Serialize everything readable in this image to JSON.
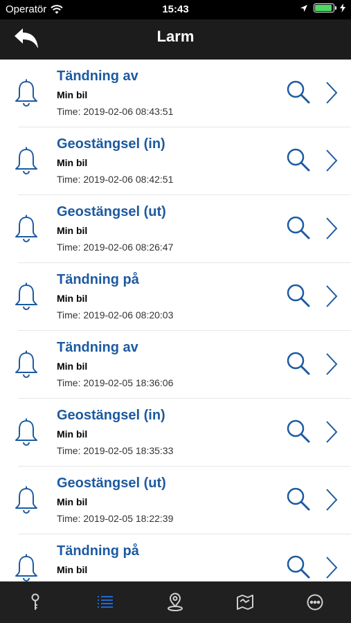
{
  "status_bar": {
    "carrier": "Operatör",
    "time": "15:43",
    "battery_color": "#4cd964"
  },
  "nav": {
    "title": "Larm",
    "back_icon": "back-arrow-icon"
  },
  "colors": {
    "accent": "#1c5aa0",
    "tab_active": "#1f6ad6",
    "tab_inactive": "#cfcfcf"
  },
  "alarms": [
    {
      "title": "Tändning av",
      "vehicle": "Min bil",
      "time": "Time: 2019-02-06 08:43:51"
    },
    {
      "title": "Geostängsel (in)",
      "vehicle": "Min bil",
      "time": "Time: 2019-02-06 08:42:51"
    },
    {
      "title": "Geostängsel (ut)",
      "vehicle": "Min bil",
      "time": "Time: 2019-02-06 08:26:47"
    },
    {
      "title": "Tändning på",
      "vehicle": "Min bil",
      "time": "Time: 2019-02-06 08:20:03"
    },
    {
      "title": "Tändning av",
      "vehicle": "Min bil",
      "time": "Time: 2019-02-05 18:36:06"
    },
    {
      "title": "Geostängsel (in)",
      "vehicle": "Min bil",
      "time": "Time: 2019-02-05 18:35:33"
    },
    {
      "title": "Geostängsel (ut)",
      "vehicle": "Min bil",
      "time": "Time: 2019-02-05 18:22:39"
    },
    {
      "title": "Tändning på",
      "vehicle": "Min bil",
      "time": ""
    }
  ],
  "tabs": [
    {
      "name": "key-icon",
      "active": false
    },
    {
      "name": "list-icon",
      "active": true
    },
    {
      "name": "location-pin-icon",
      "active": false
    },
    {
      "name": "map-icon",
      "active": false
    },
    {
      "name": "more-icon",
      "active": false
    }
  ]
}
